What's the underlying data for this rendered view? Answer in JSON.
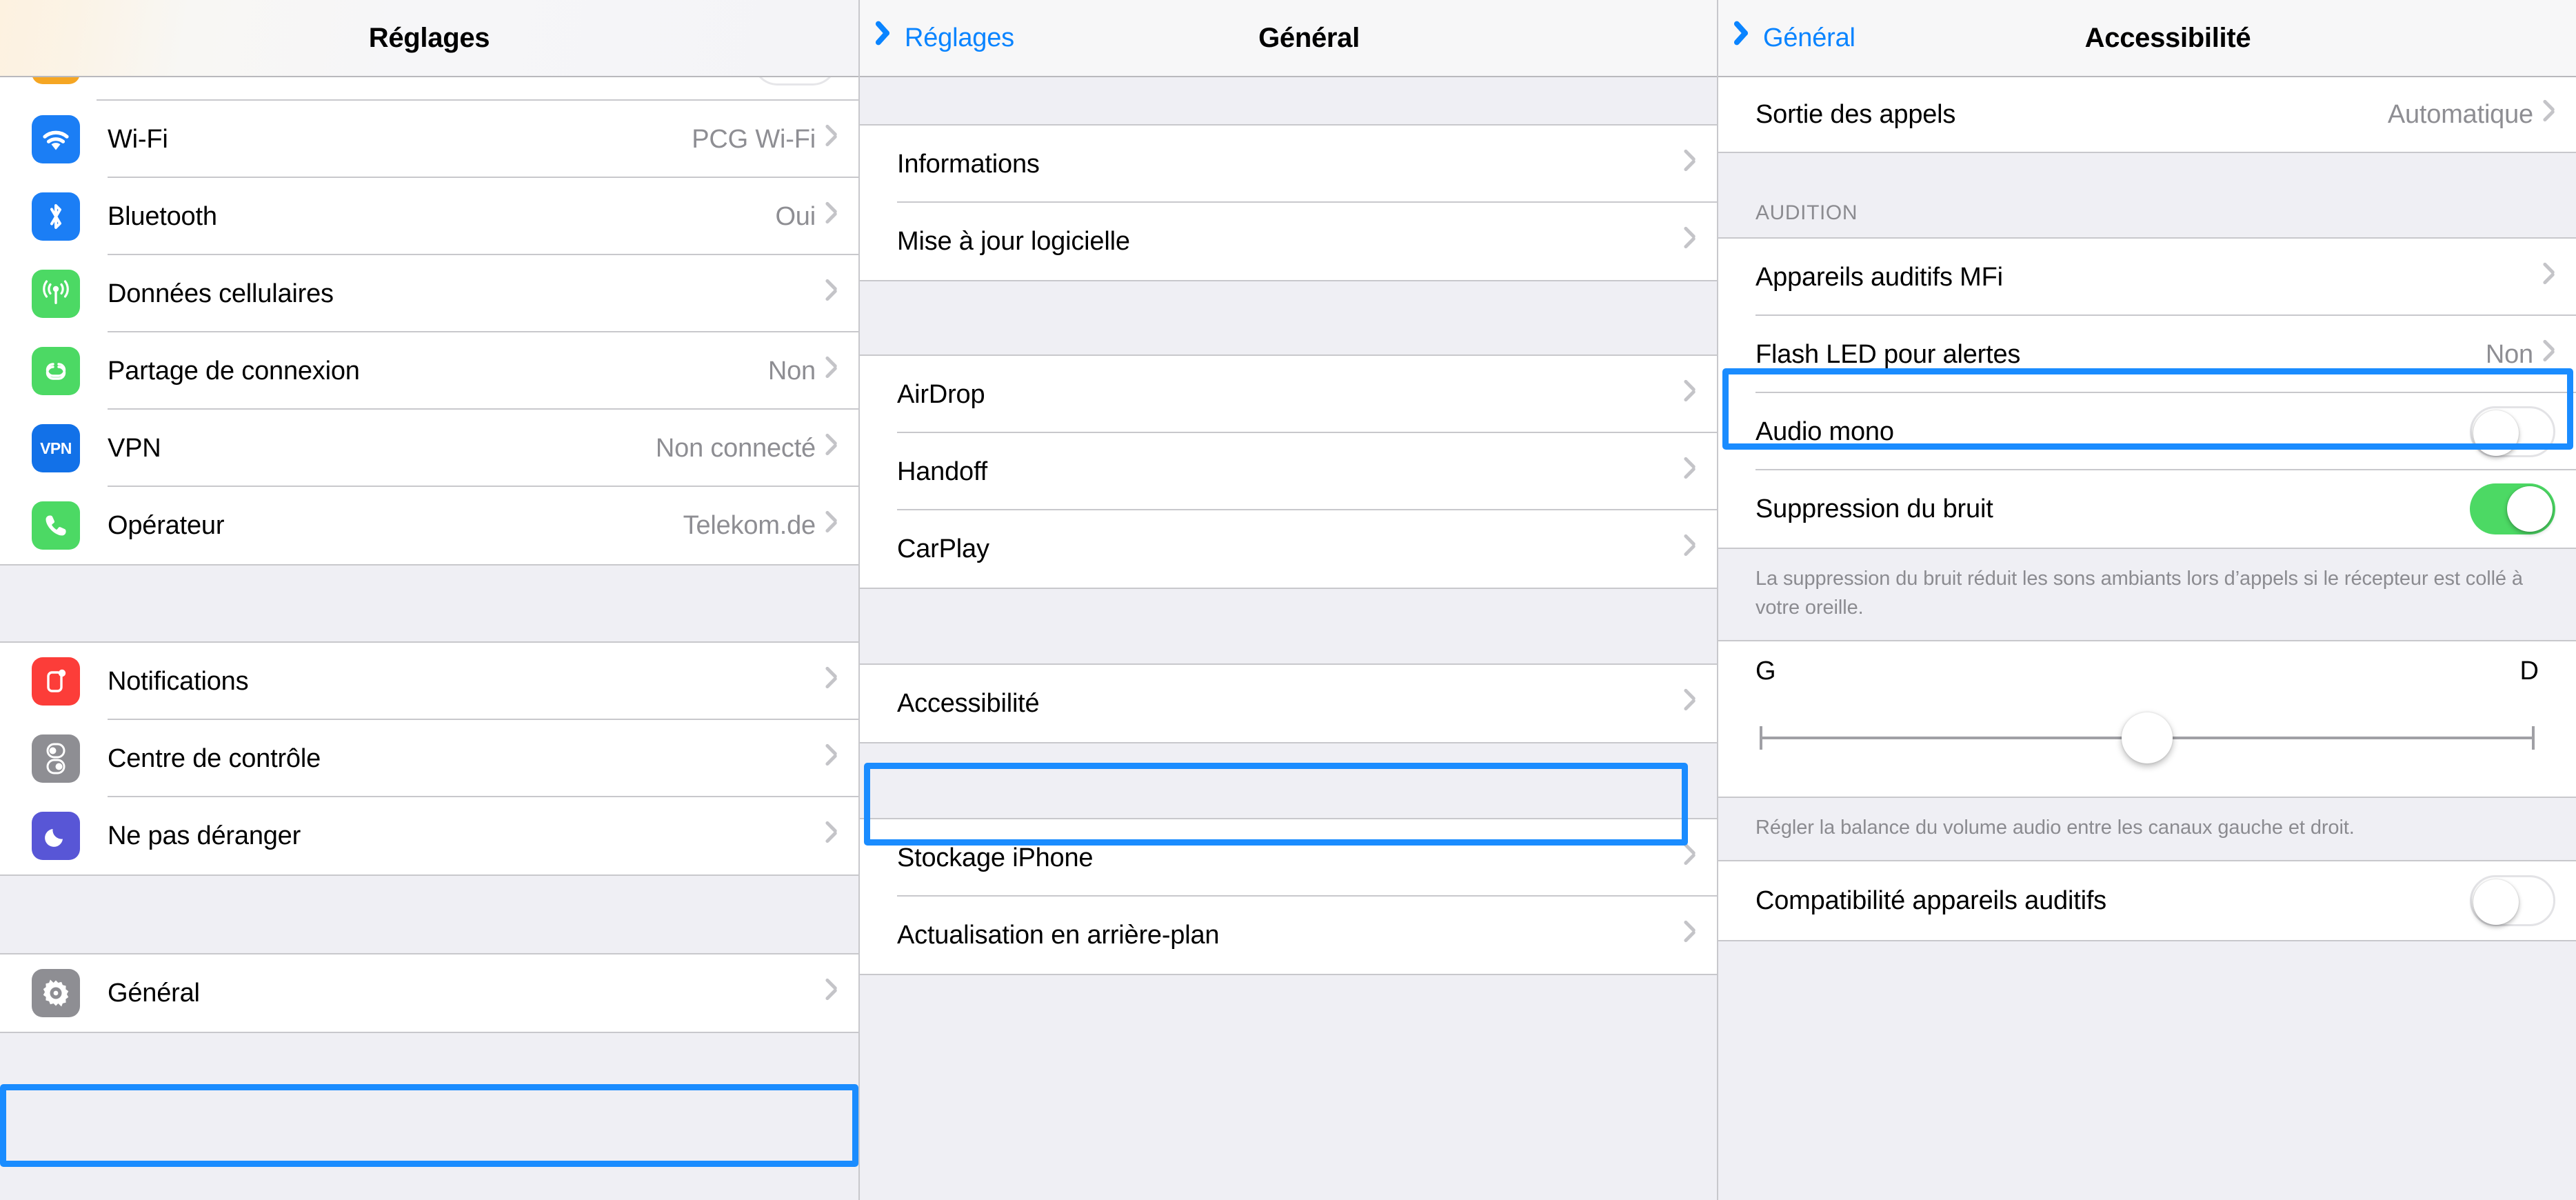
{
  "colors": {
    "highlight": "#1a8cff",
    "link": "#0a84ff",
    "toggle_on": "#4cd964",
    "muted_text": "#8e8e93",
    "group_bg": "#efeff4"
  },
  "panel_settings": {
    "nav": {
      "title": "Réglages"
    },
    "group_connectivity": [
      {
        "label": "Wi-Fi",
        "value": "PCG Wi-Fi",
        "icon": "wifi-icon",
        "icon_color": "#1b7ef5"
      },
      {
        "label": "Bluetooth",
        "value": "Oui",
        "icon": "bluetooth-icon",
        "icon_color": "#1b7ef5"
      },
      {
        "label": "Données cellulaires",
        "value": "",
        "icon": "cellular-icon",
        "icon_color": "#4cd964"
      },
      {
        "label": "Partage de connexion",
        "value": "Non",
        "icon": "hotspot-icon",
        "icon_color": "#4cd964"
      },
      {
        "label": "VPN",
        "value": "Non connecté",
        "icon": "vpn-icon",
        "icon_color": "#1b7ef5"
      },
      {
        "label": "Opérateur",
        "value": "Telekom.de",
        "icon": "phone-icon",
        "icon_color": "#4cd964"
      }
    ],
    "group_alerts": [
      {
        "label": "Notifications",
        "value": "",
        "icon": "notifications-icon",
        "icon_color": "#fc3d39"
      },
      {
        "label": "Centre de contrôle",
        "value": "",
        "icon": "control-center-icon",
        "icon_color": "#8e8e93"
      },
      {
        "label": "Ne pas déranger",
        "value": "",
        "icon": "do-not-disturb-icon",
        "icon_color": "#5856d6"
      }
    ],
    "group_system": [
      {
        "label": "Général",
        "value": "",
        "icon": "gear-icon",
        "icon_color": "#8e8e93",
        "highlighted": true
      }
    ]
  },
  "panel_general": {
    "nav": {
      "back": "Réglages",
      "title": "Général"
    },
    "group_info": [
      {
        "label": "Informations"
      },
      {
        "label": "Mise à jour logicielle"
      }
    ],
    "group_continuity": [
      {
        "label": "AirDrop"
      },
      {
        "label": "Handoff"
      },
      {
        "label": "CarPlay"
      }
    ],
    "group_accessibility": [
      {
        "label": "Accessibilité",
        "highlighted": true
      }
    ],
    "group_storage": [
      {
        "label": "Stockage iPhone"
      },
      {
        "label": "Actualisation en arrière-plan"
      }
    ]
  },
  "panel_accessibility": {
    "nav": {
      "back": "Général",
      "title": "Accessibilité"
    },
    "group_call_output": [
      {
        "label": "Sortie des appels",
        "value": "Automatique"
      }
    ],
    "section_audition": {
      "header": "AUDITION"
    },
    "group_audition": [
      {
        "label": "Appareils auditifs MFi",
        "type": "disclosure"
      },
      {
        "label": "Flash LED pour alertes",
        "value": "Non",
        "type": "disclosure",
        "highlighted": true
      },
      {
        "label": "Audio mono",
        "type": "toggle",
        "state": "off"
      },
      {
        "label": "Suppression du bruit",
        "type": "toggle",
        "state": "on"
      }
    ],
    "footnote_noise": "La suppression du bruit réduit les sons ambiants lors d’appels si le récepteur est collé à votre oreille.",
    "balance": {
      "left_label": "G",
      "right_label": "D",
      "value": 50
    },
    "footnote_balance": "Régler la balance du volume audio entre les canaux gauche et droit.",
    "group_compat": [
      {
        "label": "Compatibilité appareils auditifs",
        "type": "toggle",
        "state": "off"
      }
    ]
  }
}
